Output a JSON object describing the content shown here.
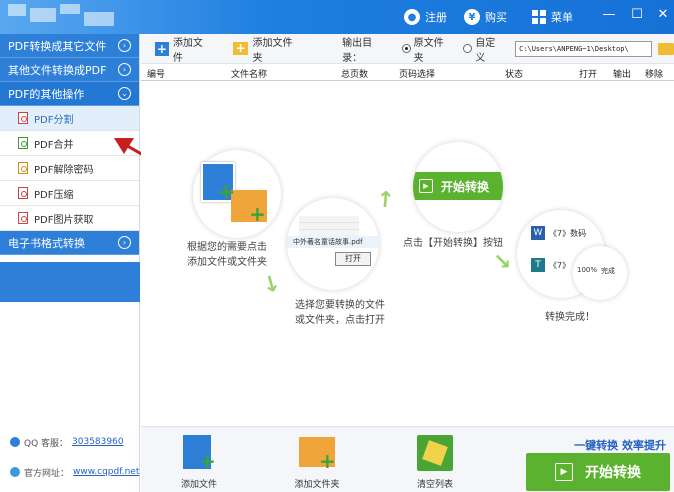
{
  "titlebar": {
    "register": "注册",
    "buy": "购买",
    "menu": "菜单",
    "minimize": "—",
    "maximize": "☐",
    "close": "✕"
  },
  "sidebar": {
    "sections": [
      {
        "label": "PDF转换成其它文件"
      },
      {
        "label": "其他文件转换成PDF"
      },
      {
        "label": "PDF的其他操作"
      },
      {
        "label": "电子书格式转换"
      }
    ],
    "items": [
      {
        "label": "PDF分割"
      },
      {
        "label": "PDF合并"
      },
      {
        "label": "PDF解除密码"
      },
      {
        "label": "PDF压缩"
      },
      {
        "label": "PDF图片获取"
      }
    ],
    "qq_label": "QQ 客服：",
    "qq_number": "303583960",
    "site_label": "官方网址：",
    "site_url": "www.cqpdf.net"
  },
  "toolbar": {
    "add_file": "添加文件",
    "add_folder": "添加文件夹",
    "output_label": "输出目录：",
    "radio_original": "原文件夹",
    "radio_custom": "自定义",
    "output_path": "C:\\Users\\ANPENG~1\\Desktop\\"
  },
  "table": {
    "headers": [
      "编号",
      "文件名称",
      "总页数",
      "页码选择",
      "状态",
      "打开",
      "输出",
      "移除"
    ]
  },
  "guide": {
    "step1": "根据您的需要点击\n添加文件或文件夹",
    "step2": "选择您要转换的文件\n或文件夹，点击打开",
    "step2_file": "中外著名童话故事.pdf",
    "step2_open": "打开",
    "step3": "点击【开始转换】按钮",
    "step3_button": "开始转换",
    "step4": "转换完成！",
    "step4_doc1": "《7》数码",
    "step4_doc2": "《7》",
    "step4_progress": "100%",
    "step4_done": "完成"
  },
  "bottombar": {
    "add_file": "添加文件",
    "add_folder": "添加文件夹",
    "clear_list": "清空列表",
    "slogan": "一键转换  效率提升",
    "start": "开始转换"
  },
  "colors": {
    "brand_blue": "#2d7fd8",
    "accent_green": "#5ab22f"
  }
}
